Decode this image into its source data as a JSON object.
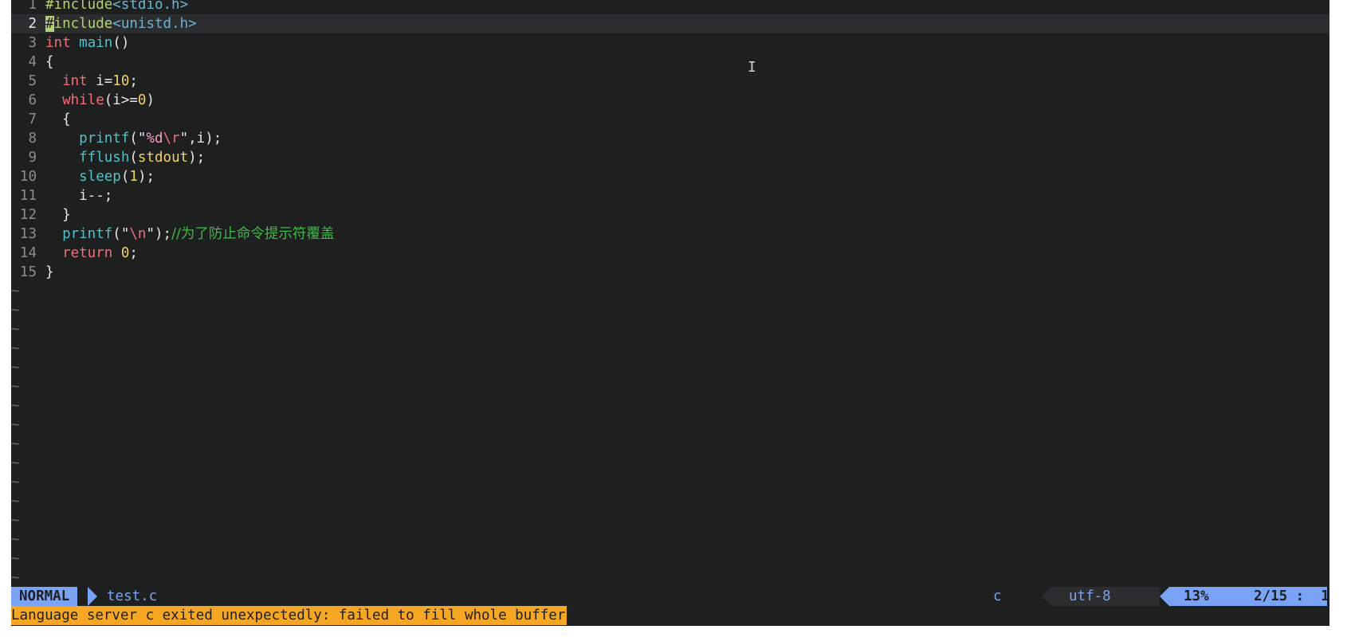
{
  "editor": {
    "current_line": 2,
    "lines": [
      {
        "num": "1",
        "parts": [
          [
            "c-pre",
            "#include"
          ],
          [
            "c-hdr",
            "<stdio.h>"
          ]
        ]
      },
      {
        "num": "2",
        "parts": [
          [
            "cursor",
            "#"
          ],
          [
            "c-pre",
            "include"
          ],
          [
            "c-hdr",
            "<unistd.h>"
          ]
        ]
      },
      {
        "num": "3",
        "parts": [
          [
            "c-kw",
            "int"
          ],
          [
            "c-txt",
            " "
          ],
          [
            "c-fn",
            "main"
          ],
          [
            "c-txt",
            "()"
          ]
        ]
      },
      {
        "num": "4",
        "parts": [
          [
            "c-txt",
            "{"
          ]
        ]
      },
      {
        "num": "5",
        "parts": [
          [
            "c-txt",
            "  "
          ],
          [
            "c-kw",
            "int"
          ],
          [
            "c-txt",
            " i="
          ],
          [
            "c-num",
            "10"
          ],
          [
            "c-txt",
            ";"
          ]
        ]
      },
      {
        "num": "6",
        "parts": [
          [
            "c-txt",
            "  "
          ],
          [
            "c-kw",
            "while"
          ],
          [
            "c-txt",
            "(i>="
          ],
          [
            "c-num",
            "0"
          ],
          [
            "c-txt",
            ")"
          ]
        ]
      },
      {
        "num": "7",
        "parts": [
          [
            "c-txt",
            "  {"
          ]
        ]
      },
      {
        "num": "8",
        "parts": [
          [
            "c-txt",
            "    "
          ],
          [
            "c-fn",
            "printf"
          ],
          [
            "c-txt",
            "(\""
          ],
          [
            "c-fmt",
            "%d"
          ],
          [
            "c-esc",
            "\\r"
          ],
          [
            "c-txt",
            "\",i);"
          ]
        ]
      },
      {
        "num": "9",
        "parts": [
          [
            "c-txt",
            "    "
          ],
          [
            "c-fn",
            "fflush"
          ],
          [
            "c-txt",
            "("
          ],
          [
            "c-num",
            "stdout"
          ],
          [
            "c-txt",
            ");"
          ]
        ]
      },
      {
        "num": "10",
        "parts": [
          [
            "c-txt",
            "    "
          ],
          [
            "c-fn",
            "sleep"
          ],
          [
            "c-txt",
            "("
          ],
          [
            "c-num",
            "1"
          ],
          [
            "c-txt",
            ");"
          ]
        ]
      },
      {
        "num": "11",
        "parts": [
          [
            "c-txt",
            "    i--;"
          ]
        ]
      },
      {
        "num": "12",
        "parts": [
          [
            "c-txt",
            "  }"
          ]
        ]
      },
      {
        "num": "13",
        "parts": [
          [
            "c-txt",
            "  "
          ],
          [
            "c-fn",
            "printf"
          ],
          [
            "c-txt",
            "(\""
          ],
          [
            "c-esc",
            "\\n"
          ],
          [
            "c-txt",
            "\");"
          ],
          [
            "c-cmt",
            "//为了防止命令提示符覆盖"
          ]
        ]
      },
      {
        "num": "14",
        "parts": [
          [
            "c-txt",
            "  "
          ],
          [
            "c-kw",
            "return"
          ],
          [
            "c-txt",
            " "
          ],
          [
            "c-num",
            "0"
          ],
          [
            "c-txt",
            ";"
          ]
        ]
      },
      {
        "num": "15",
        "parts": [
          [
            "c-txt",
            "}"
          ]
        ]
      }
    ],
    "tilde_count": 16,
    "tilde_char": "~"
  },
  "statusline": {
    "mode": "NORMAL",
    "filename": "test.c",
    "filetype": "c",
    "encoding": "utf-8",
    "percent": "13%",
    "position": "2/15 :  1"
  },
  "message": "Language server c exited unexpectedly: failed to fill whole buffer",
  "colors": {
    "background": "#1e1f1f",
    "accent": "#7aa3f5",
    "warning": "#f5a623"
  }
}
